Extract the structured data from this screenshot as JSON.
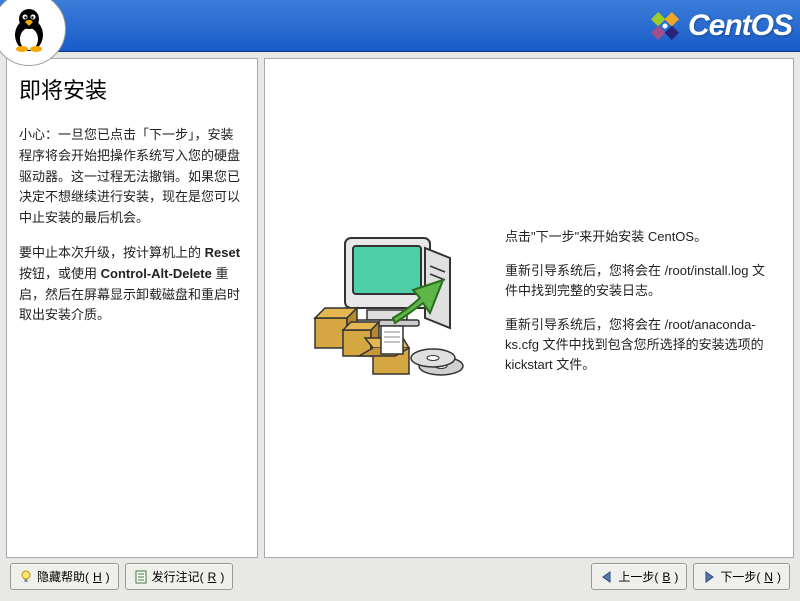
{
  "header": {
    "brand": "CentOS"
  },
  "help": {
    "title": "即将安装",
    "p1_prefix": "小心：一旦您已点击「下一步」，安装程序将会开始把操作系统写入您的硬盘驱动器。这一过程无法撤销。如果您已决定不想继续进行安装，现在是您可以中止安装的最后机会。",
    "p2_part1": "要中止本次升级，按计算机上的 ",
    "p2_reset": "Reset",
    "p2_part2": " 按钮，或使用 ",
    "p2_cad": "Control-Alt-Delete",
    "p2_part3": " 重启，然后在屏幕显示卸载磁盘和重启时取出安装介质。"
  },
  "main": {
    "p1": "点击\"下一步\"来开始安装 CentOS。",
    "p2": "重新引导系统后，您将会在 /root/install.log 文件中找到完整的安装日志。",
    "p3": "重新引导系统后，您将会在 /root/anaconda-ks.cfg 文件中找到包含您所选择的安装选项的 kickstart 文件。"
  },
  "buttons": {
    "hide_help": "隐藏帮助(",
    "hide_help_u": "H",
    "hide_help_end": ")",
    "release_notes": "发行注记(",
    "release_notes_u": "R",
    "release_notes_end": ")",
    "back": "上一步(",
    "back_u": "B",
    "back_end": ")",
    "next": "下一步(",
    "next_u": "N",
    "next_end": ")"
  }
}
